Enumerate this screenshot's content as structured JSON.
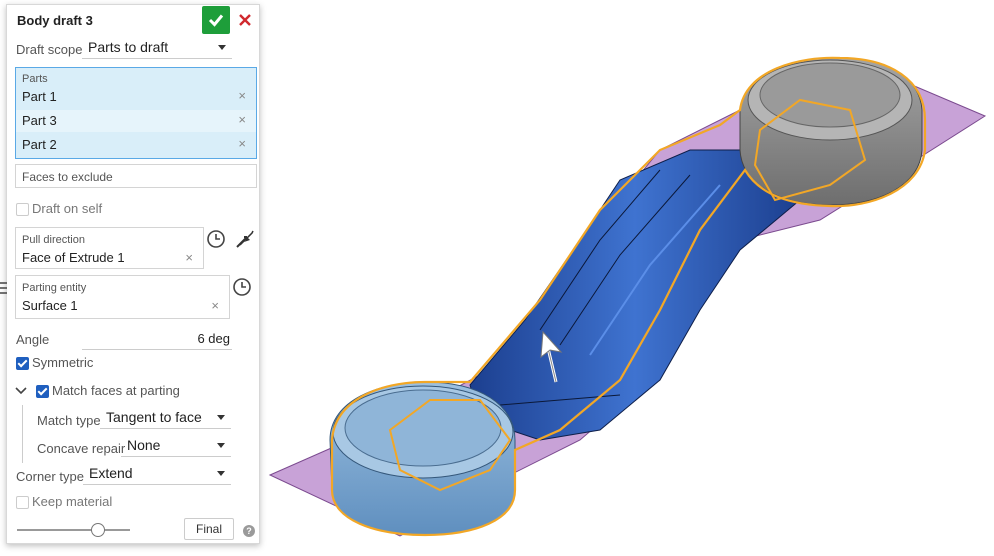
{
  "dialog": {
    "title": "Body draft 3",
    "draft_scope_label": "Draft scope",
    "draft_scope_value": "Parts to draft",
    "parts_label": "Parts",
    "parts": [
      "Part 1",
      "Part 3",
      "Part 2"
    ],
    "faces_to_exclude_placeholder": "Faces to exclude",
    "draft_on_self_label": "Draft on self",
    "draft_on_self_checked": false,
    "pull_direction_label": "Pull direction",
    "pull_direction_value": "Face of Extrude 1",
    "parting_entity_label": "Parting entity",
    "parting_entity_value": "Surface 1",
    "angle_label": "Angle",
    "angle_value": "6 deg",
    "symmetric_label": "Symmetric",
    "symmetric_checked": true,
    "match_faces_label": "Match faces at parting",
    "match_faces_checked": true,
    "match_type_label": "Match type",
    "match_type_value": "Tangent to face",
    "concave_repair_label": "Concave repair",
    "concave_repair_value": "None",
    "corner_type_label": "Corner type",
    "corner_type_value": "Extend",
    "keep_material_label": "Keep material",
    "keep_material_checked": false,
    "final_button": "Final",
    "remove_glyph": "×",
    "help_glyph": "?",
    "rollback_slider_fraction": 0.7
  },
  "icons": {
    "accept": "check-icon",
    "cancel": "close-icon",
    "history": "clock-icon",
    "flip": "flip-direction-icon",
    "list": "list-icon",
    "expand": "chevron-down-icon",
    "help": "help-icon"
  },
  "colors": {
    "accept_green": "#1e9e3a",
    "cancel_red": "#d0282e",
    "selection_blue": "#d9eef9",
    "parting_surface": "#b583c9",
    "highlight_orange": "#f2a726",
    "part_blue": "#2f5fb8",
    "part_gray": "#8c8c8c"
  }
}
